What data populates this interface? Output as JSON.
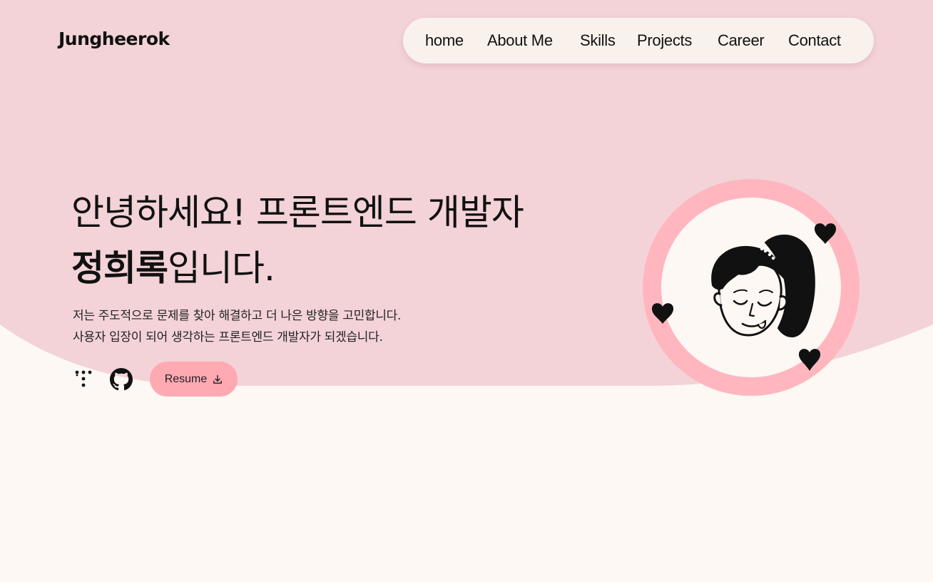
{
  "header": {
    "logo": "Jungheerok"
  },
  "nav": {
    "items": [
      {
        "label": "home"
      },
      {
        "label": "About Me"
      },
      {
        "label": "Skills"
      },
      {
        "label": "Projects"
      },
      {
        "label": "Career"
      },
      {
        "label": "Contact"
      }
    ]
  },
  "hero": {
    "headline_line1": "안녕하세요! 프론트엔드 개발자",
    "headline_name": "정희록",
    "headline_suffix": "입니다.",
    "description_line1": "저는 주도적으로 문제를 찾아 해결하고 더 나은 방향을 고민합니다.",
    "description_line2": "사용자 입장이 되어 생각하는 프론트엔드 개발자가 되겠습니다.",
    "resume_label": "Resume",
    "social_icons": [
      "tistory-icon",
      "github-icon"
    ],
    "resume_icon": "download-icon"
  },
  "avatar": {
    "icon": "girl-illustration-icon",
    "decorations": [
      "heart-icon",
      "heart-icon",
      "heart-icon"
    ]
  },
  "colors": {
    "hero_background": "#f3d3d8",
    "page_background": "#fdf8f4",
    "nav_background": "#f9f1ec",
    "accent": "#ffa9b2",
    "avatar_ring": "#ffb6bf",
    "text": "#111111"
  }
}
